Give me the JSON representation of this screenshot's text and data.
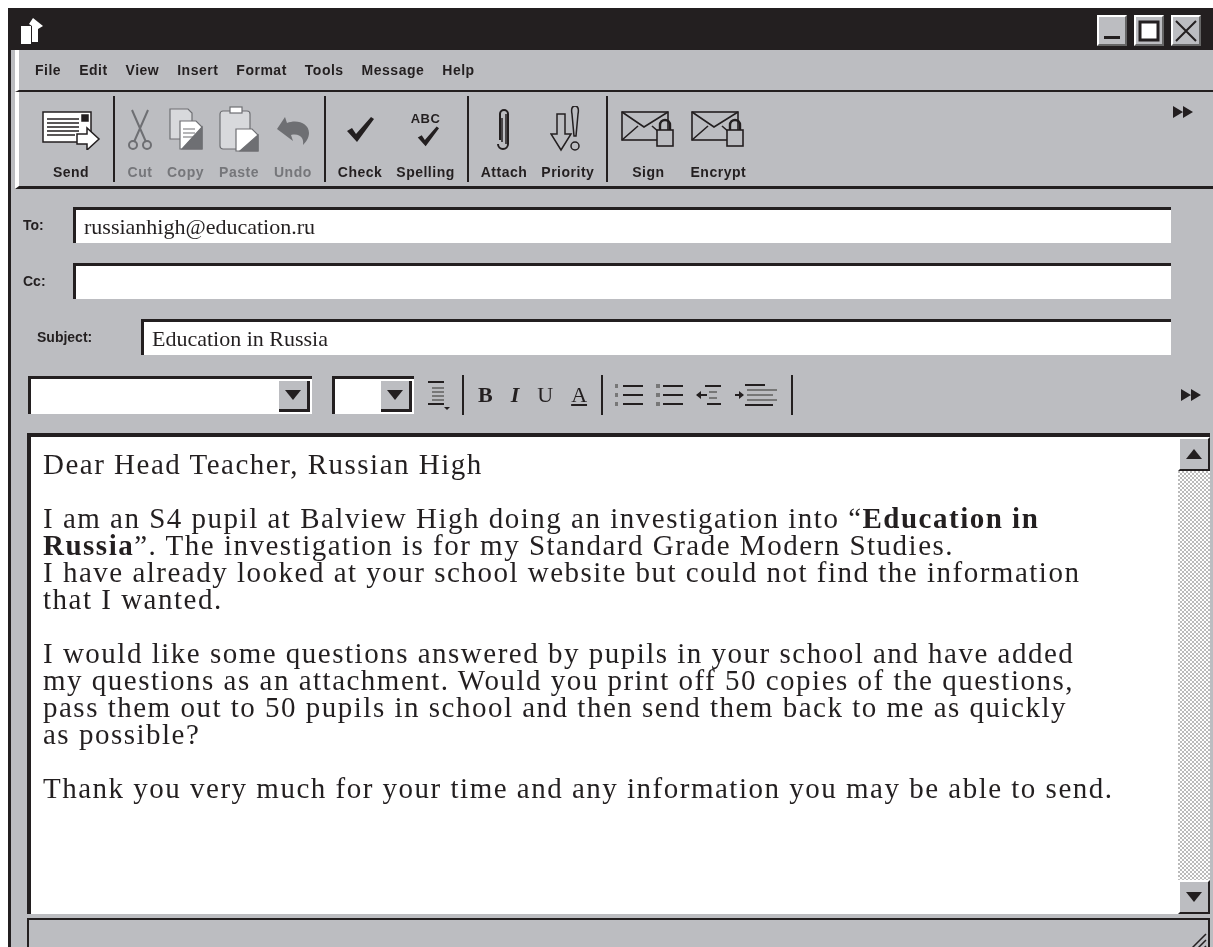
{
  "menu": [
    "File",
    "Edit",
    "View",
    "Insert",
    "Format",
    "Tools",
    "Message",
    "Help"
  ],
  "toolbar": [
    [
      {
        "kind": "send",
        "label": "Send",
        "disabled": false
      }
    ],
    [
      {
        "kind": "cut",
        "label": "Cut",
        "disabled": true
      },
      {
        "kind": "copy",
        "label": "Copy",
        "disabled": true
      },
      {
        "kind": "paste",
        "label": "Paste",
        "disabled": true
      },
      {
        "kind": "undo",
        "label": "Undo",
        "disabled": true
      }
    ],
    [
      {
        "kind": "check",
        "label": "Check",
        "disabled": false
      },
      {
        "kind": "spelling",
        "label": "Spelling",
        "disabled": false
      }
    ],
    [
      {
        "kind": "attach",
        "label": "Attach",
        "disabled": false
      },
      {
        "kind": "priority",
        "label": "Priority",
        "disabled": false
      }
    ],
    [
      {
        "kind": "sign",
        "label": "Sign",
        "disabled": false
      },
      {
        "kind": "encrypt",
        "label": "Encrypt",
        "disabled": false
      }
    ]
  ],
  "spelling_icon_text": "ABC",
  "fields": [
    {
      "label": "To:",
      "value": "russianhigh@education.ru"
    },
    {
      "label": "Cc:"
    },
    {
      "label": "Subject:",
      "value": "Education in Russia"
    }
  ],
  "format_bar": {
    "bold": "B",
    "italic": "I",
    "underline": "U",
    "font_color": "A"
  },
  "body": [
    "Dear Head Teacher, Russian High",
    "I am an S4 pupil at Balview High doing an investigation into “**Education in Russia**”.  The investigation is for my Standard Grade Modern Studies.\nI have already looked at your school website but could not find the information\nthat I wanted.",
    "I would like some questions answered by pupils in your school and have added\nmy questions as an attachment.  Would you print off 50 copies of the questions,\npass them out to 50 pupils in school and then send them back to me as quickly\nas possible?",
    "Thank you very much for your time and any information you may be able to send."
  ]
}
